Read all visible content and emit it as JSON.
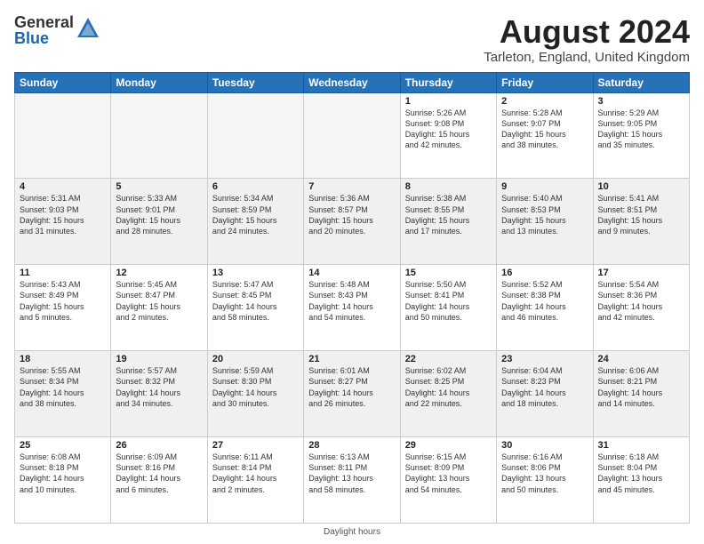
{
  "logo": {
    "general": "General",
    "blue": "Blue"
  },
  "title": "August 2024",
  "location": "Tarleton, England, United Kingdom",
  "days_of_week": [
    "Sunday",
    "Monday",
    "Tuesday",
    "Wednesday",
    "Thursday",
    "Friday",
    "Saturday"
  ],
  "footer_text": "Daylight hours",
  "weeks": [
    [
      {
        "day": "",
        "info": ""
      },
      {
        "day": "",
        "info": ""
      },
      {
        "day": "",
        "info": ""
      },
      {
        "day": "",
        "info": ""
      },
      {
        "day": "1",
        "info": "Sunrise: 5:26 AM\nSunset: 9:08 PM\nDaylight: 15 hours\nand 42 minutes."
      },
      {
        "day": "2",
        "info": "Sunrise: 5:28 AM\nSunset: 9:07 PM\nDaylight: 15 hours\nand 38 minutes."
      },
      {
        "day": "3",
        "info": "Sunrise: 5:29 AM\nSunset: 9:05 PM\nDaylight: 15 hours\nand 35 minutes."
      }
    ],
    [
      {
        "day": "4",
        "info": "Sunrise: 5:31 AM\nSunset: 9:03 PM\nDaylight: 15 hours\nand 31 minutes."
      },
      {
        "day": "5",
        "info": "Sunrise: 5:33 AM\nSunset: 9:01 PM\nDaylight: 15 hours\nand 28 minutes."
      },
      {
        "day": "6",
        "info": "Sunrise: 5:34 AM\nSunset: 8:59 PM\nDaylight: 15 hours\nand 24 minutes."
      },
      {
        "day": "7",
        "info": "Sunrise: 5:36 AM\nSunset: 8:57 PM\nDaylight: 15 hours\nand 20 minutes."
      },
      {
        "day": "8",
        "info": "Sunrise: 5:38 AM\nSunset: 8:55 PM\nDaylight: 15 hours\nand 17 minutes."
      },
      {
        "day": "9",
        "info": "Sunrise: 5:40 AM\nSunset: 8:53 PM\nDaylight: 15 hours\nand 13 minutes."
      },
      {
        "day": "10",
        "info": "Sunrise: 5:41 AM\nSunset: 8:51 PM\nDaylight: 15 hours\nand 9 minutes."
      }
    ],
    [
      {
        "day": "11",
        "info": "Sunrise: 5:43 AM\nSunset: 8:49 PM\nDaylight: 15 hours\nand 5 minutes."
      },
      {
        "day": "12",
        "info": "Sunrise: 5:45 AM\nSunset: 8:47 PM\nDaylight: 15 hours\nand 2 minutes."
      },
      {
        "day": "13",
        "info": "Sunrise: 5:47 AM\nSunset: 8:45 PM\nDaylight: 14 hours\nand 58 minutes."
      },
      {
        "day": "14",
        "info": "Sunrise: 5:48 AM\nSunset: 8:43 PM\nDaylight: 14 hours\nand 54 minutes."
      },
      {
        "day": "15",
        "info": "Sunrise: 5:50 AM\nSunset: 8:41 PM\nDaylight: 14 hours\nand 50 minutes."
      },
      {
        "day": "16",
        "info": "Sunrise: 5:52 AM\nSunset: 8:38 PM\nDaylight: 14 hours\nand 46 minutes."
      },
      {
        "day": "17",
        "info": "Sunrise: 5:54 AM\nSunset: 8:36 PM\nDaylight: 14 hours\nand 42 minutes."
      }
    ],
    [
      {
        "day": "18",
        "info": "Sunrise: 5:55 AM\nSunset: 8:34 PM\nDaylight: 14 hours\nand 38 minutes."
      },
      {
        "day": "19",
        "info": "Sunrise: 5:57 AM\nSunset: 8:32 PM\nDaylight: 14 hours\nand 34 minutes."
      },
      {
        "day": "20",
        "info": "Sunrise: 5:59 AM\nSunset: 8:30 PM\nDaylight: 14 hours\nand 30 minutes."
      },
      {
        "day": "21",
        "info": "Sunrise: 6:01 AM\nSunset: 8:27 PM\nDaylight: 14 hours\nand 26 minutes."
      },
      {
        "day": "22",
        "info": "Sunrise: 6:02 AM\nSunset: 8:25 PM\nDaylight: 14 hours\nand 22 minutes."
      },
      {
        "day": "23",
        "info": "Sunrise: 6:04 AM\nSunset: 8:23 PM\nDaylight: 14 hours\nand 18 minutes."
      },
      {
        "day": "24",
        "info": "Sunrise: 6:06 AM\nSunset: 8:21 PM\nDaylight: 14 hours\nand 14 minutes."
      }
    ],
    [
      {
        "day": "25",
        "info": "Sunrise: 6:08 AM\nSunset: 8:18 PM\nDaylight: 14 hours\nand 10 minutes."
      },
      {
        "day": "26",
        "info": "Sunrise: 6:09 AM\nSunset: 8:16 PM\nDaylight: 14 hours\nand 6 minutes."
      },
      {
        "day": "27",
        "info": "Sunrise: 6:11 AM\nSunset: 8:14 PM\nDaylight: 14 hours\nand 2 minutes."
      },
      {
        "day": "28",
        "info": "Sunrise: 6:13 AM\nSunset: 8:11 PM\nDaylight: 13 hours\nand 58 minutes."
      },
      {
        "day": "29",
        "info": "Sunrise: 6:15 AM\nSunset: 8:09 PM\nDaylight: 13 hours\nand 54 minutes."
      },
      {
        "day": "30",
        "info": "Sunrise: 6:16 AM\nSunset: 8:06 PM\nDaylight: 13 hours\nand 50 minutes."
      },
      {
        "day": "31",
        "info": "Sunrise: 6:18 AM\nSunset: 8:04 PM\nDaylight: 13 hours\nand 45 minutes."
      }
    ]
  ]
}
